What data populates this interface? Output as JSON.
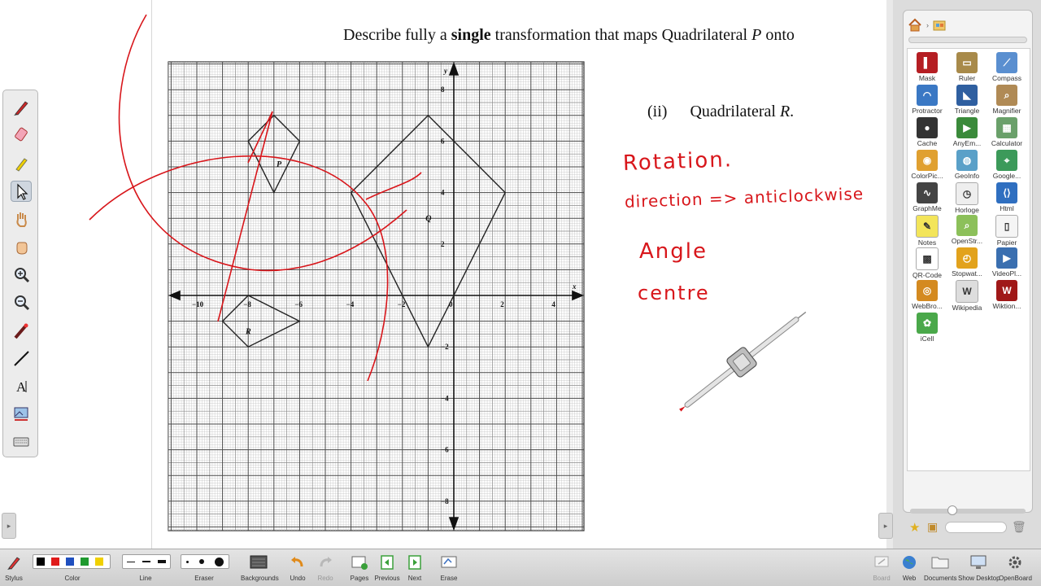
{
  "document": {
    "question_prefix": "Describe fully a ",
    "question_bold": "single",
    "question_middle": " transformation that maps Quadrilateral ",
    "question_italic": "P",
    "question_suffix": " onto",
    "part_number": "(ii)",
    "part_text_prefix": "Quadrilateral ",
    "part_text_italic": "R",
    "part_text_suffix": "."
  },
  "graph": {
    "x_axis_label": "x",
    "y_axis_label": "y",
    "x_ticks": [
      "−10",
      "−8",
      "−6",
      "−4",
      "−2",
      "0",
      "2",
      "4"
    ],
    "y_ticks": [
      "8",
      "6",
      "4",
      "2",
      "−2",
      "−4",
      "−6",
      "−8"
    ],
    "shape_labels": [
      "P",
      "Q",
      "R"
    ]
  },
  "handwriting": {
    "line1": "Rotation.",
    "line2": "direction => anticlockwise",
    "line3": "Angle",
    "line4": "centre"
  },
  "left_tools": [
    "pen-icon",
    "marker-icon",
    "highlighter-icon",
    "pointer-icon",
    "hand-icon",
    "grab-icon",
    "zoom-in-icon",
    "zoom-out-icon",
    "laser-icon",
    "line-icon",
    "text-icon",
    "capture-icon",
    "keyboard-icon"
  ],
  "library": {
    "items": [
      {
        "label": "Mask",
        "color": "#b51e23"
      },
      {
        "label": "Ruler",
        "color": "#a88a4a"
      },
      {
        "label": "Compass",
        "color": "#5a8fd0"
      },
      {
        "label": "Protractor",
        "color": "#3a78c4"
      },
      {
        "label": "Triangle",
        "color": "#2f5fa0"
      },
      {
        "label": "Magnifier",
        "color": "#b08a55"
      },
      {
        "label": "Cache",
        "color": "#333333"
      },
      {
        "label": "AnyEm...",
        "color": "#3a8a3a"
      },
      {
        "label": "Calculator",
        "color": "#6aa06a"
      },
      {
        "label": "ColorPic...",
        "color": "#e0a030"
      },
      {
        "label": "GeoInfo",
        "color": "#5aa0c8"
      },
      {
        "label": "Google...",
        "color": "#3c9a5a"
      },
      {
        "label": "GraphMe",
        "color": "#444444"
      },
      {
        "label": "Horloge",
        "color": "#eeeeee"
      },
      {
        "label": "Html",
        "color": "#2f6fc0"
      },
      {
        "label": "Notes",
        "color": "#f3e55a"
      },
      {
        "label": "OpenStr...",
        "color": "#8cc05a"
      },
      {
        "label": "Papier",
        "color": "#f5f5f5"
      },
      {
        "label": "QR-Code",
        "color": "#ffffff"
      },
      {
        "label": "Stopwat...",
        "color": "#e2a21c"
      },
      {
        "label": "VideoPl...",
        "color": "#3a6fb0"
      },
      {
        "label": "WebBro...",
        "color": "#d48a20"
      },
      {
        "label": "Wikipedia",
        "color": "#dddddd"
      },
      {
        "label": "Wiktion...",
        "color": "#a01818"
      },
      {
        "label": "iCell",
        "color": "#4aa84a"
      }
    ]
  },
  "bottom_bar": {
    "stylus": "Stylus",
    "color": "Color",
    "line": "Line",
    "eraser": "Eraser",
    "backgrounds": "Backgrounds",
    "undo": "Undo",
    "redo": "Redo",
    "pages": "Pages",
    "previous": "Previous",
    "next": "Next",
    "erase": "Erase",
    "board": "Board",
    "web": "Web",
    "documents": "Documents",
    "show_desktop": "Show Desktop",
    "openboard": "OpenBoard"
  },
  "palette_colors": [
    "#000000",
    "#e01b1b",
    "#1f4fbf",
    "#1f9a2f",
    "#f0d000"
  ]
}
